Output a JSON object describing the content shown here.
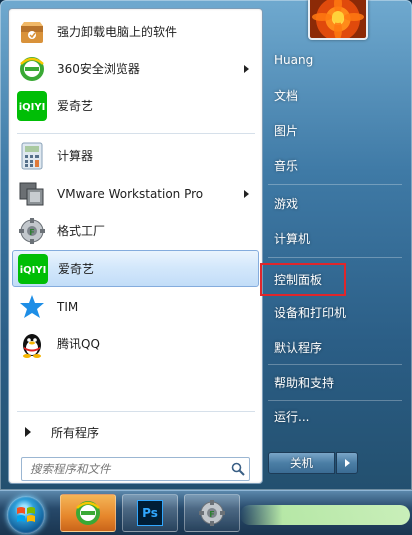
{
  "left_pane": {
    "programs": [
      {
        "label": "强力卸载电脑上的软件",
        "icon": "uninstaller-box-icon",
        "submenu": false,
        "highlighted": false
      },
      {
        "label": "360安全浏览器",
        "icon": "360-browser-icon",
        "submenu": true,
        "highlighted": false
      },
      {
        "label": "爱奇艺",
        "icon": "iqiyi-icon",
        "submenu": false,
        "highlighted": false
      },
      {
        "label": "计算器",
        "icon": "calculator-icon",
        "submenu": false,
        "highlighted": false
      },
      {
        "label": "VMware Workstation Pro",
        "icon": "vmware-icon",
        "submenu": true,
        "highlighted": false
      },
      {
        "label": "格式工厂",
        "icon": "format-factory-icon",
        "submenu": false,
        "highlighted": false
      },
      {
        "label": "爱奇艺",
        "icon": "iqiyi-icon",
        "submenu": false,
        "highlighted": true
      },
      {
        "label": "TIM",
        "icon": "tim-star-icon",
        "submenu": false,
        "highlighted": false
      },
      {
        "label": "腾讯QQ",
        "icon": "qq-penguin-icon",
        "submenu": false,
        "highlighted": false
      }
    ],
    "all_programs_label": "所有程序",
    "search": {
      "placeholder": "搜索程序和文件",
      "value": ""
    }
  },
  "right_pane": {
    "places": [
      {
        "label": "Huang",
        "name": "user-name"
      },
      {
        "label": "文档",
        "name": "documents"
      },
      {
        "label": "图片",
        "name": "pictures"
      },
      {
        "label": "音乐",
        "name": "music"
      },
      {
        "label": "游戏",
        "name": "games"
      },
      {
        "label": "计算机",
        "name": "computer"
      },
      {
        "label": "控制面板",
        "name": "control-panel"
      },
      {
        "label": "设备和打印机",
        "name": "devices-and-printers"
      },
      {
        "label": "默认程序",
        "name": "default-programs"
      },
      {
        "label": "帮助和支持",
        "name": "help-and-support"
      },
      {
        "label": "运行...",
        "name": "run"
      }
    ],
    "shutdown_label": "关机",
    "highlighted_item": "控制面板"
  },
  "taskbar": {
    "items": [
      {
        "name": "start-orb",
        "icon": "windows-logo-icon"
      },
      {
        "name": "360-browser",
        "icon": "360-browser-icon",
        "active": true
      },
      {
        "name": "photoshop",
        "icon": "photoshop-icon",
        "label": "Ps",
        "active": false
      },
      {
        "name": "format-factory",
        "icon": "format-factory-icon",
        "active": false
      }
    ]
  },
  "colors": {
    "accent_highlight_border": "#e0262b",
    "menu_frame": "#3f7aa6",
    "item_hover": "#c2ddf8",
    "iqiyi_green": "#00be06",
    "ps_blue": "#001e36"
  }
}
